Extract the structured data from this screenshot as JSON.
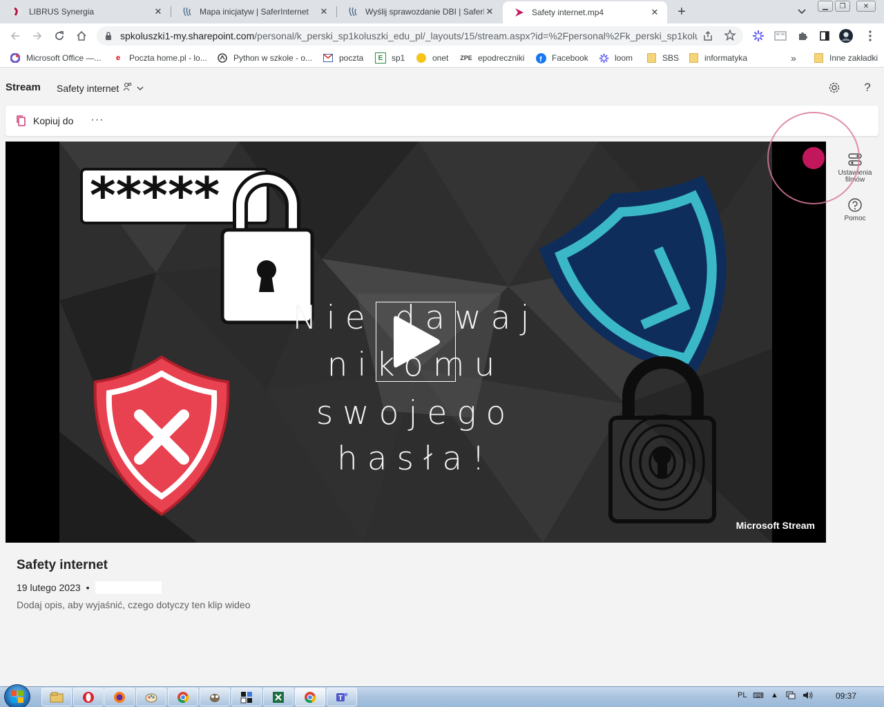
{
  "browser": {
    "tabs": [
      {
        "title": "LIBRUS Synergia",
        "icon": "librus-icon",
        "active": false
      },
      {
        "title": "Mapa inicjatyw | SaferInternet",
        "icon": "saferinternet-icon",
        "active": false
      },
      {
        "title": "Wyślij sprawozdanie DBI | SaferIn",
        "icon": "saferinternet-icon",
        "active": false
      },
      {
        "title": "Safety internet.mp4",
        "icon": "stream-icon",
        "active": true
      }
    ],
    "url_host": "spkoluszki1-my.sharepoint.com",
    "url_path": "/personal/k_perski_sp1koluszki_edu_pl/_layouts/15/stream.aspx?id=%2Fpersonal%2Fk_perski_sp1kolu...",
    "bookmarks": [
      {
        "label": "Microsoft Office —...",
        "icon": "office-icon"
      },
      {
        "label": "Poczta home.pl - lo...",
        "icon": "homepl-icon"
      },
      {
        "label": "Python w szkole - o...",
        "icon": "python-school-icon"
      },
      {
        "label": "poczta",
        "icon": "gmail-icon"
      },
      {
        "label": "sp1",
        "icon": "sp1-icon"
      },
      {
        "label": "onet",
        "icon": "onet-icon"
      },
      {
        "label": "epodreczniki",
        "icon": "zpe-icon"
      },
      {
        "label": "Facebook",
        "icon": "facebook-icon"
      },
      {
        "label": "loom",
        "icon": "loom-icon"
      },
      {
        "label": "SBS",
        "icon": "folder-icon"
      },
      {
        "label": "informatyka",
        "icon": "folder-icon"
      }
    ],
    "bookmarks_overflow": "»",
    "other_bookmarks": "Inne zakładki"
  },
  "app": {
    "name": "Stream",
    "breadcrumb": "Safety internet",
    "commands": {
      "copy_to": "Kopiuj do",
      "more": "···"
    }
  },
  "player": {
    "slide_lines": [
      "Nie dawaj",
      "nikomu",
      "swojego",
      "hasła!"
    ],
    "password_mask": "*****",
    "brand": "Microsoft Stream"
  },
  "rail": {
    "video_settings": "Ustawienia filmów",
    "help": "Pomoc"
  },
  "video": {
    "title": "Safety internet",
    "date": "19 lutego 2023",
    "separator": "•",
    "description": "Dodaj opis, aby wyjaśnić, czego dotyczy ten klip wideo"
  },
  "taskbar": {
    "language": "PL",
    "clock": "09:37"
  },
  "colors": {
    "stream_accent": "#c2185b",
    "shield_red": "#e8414f",
    "shield_blue": "#0f2d5a",
    "shield_teal": "#3bb8c8",
    "win7_taskbar": "#a9c3df"
  }
}
